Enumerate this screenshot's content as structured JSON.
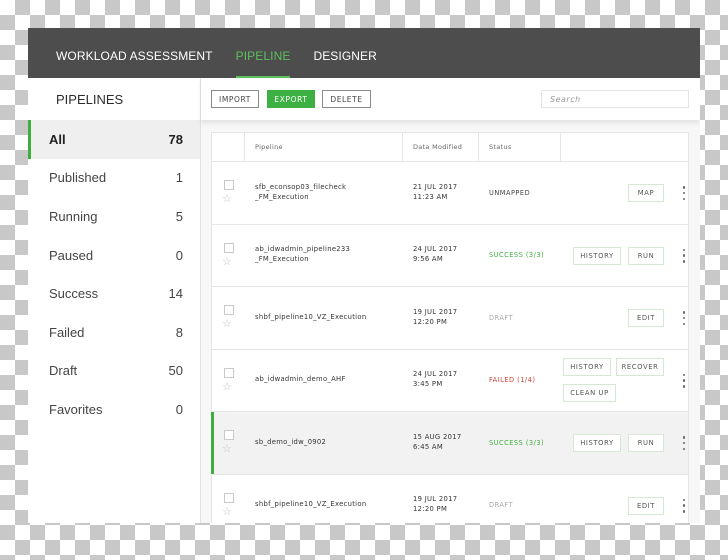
{
  "nav": {
    "tabs": [
      {
        "label": "WORKLOAD ASSESSMENT",
        "active": false
      },
      {
        "label": "PIPELINE",
        "active": true
      },
      {
        "label": "DESIGNER",
        "active": false
      }
    ]
  },
  "sidebar": {
    "title": "PIPELINES",
    "items": [
      {
        "label": "All",
        "count": "78",
        "active": true
      },
      {
        "label": "Published",
        "count": "1"
      },
      {
        "label": "Running",
        "count": "5"
      },
      {
        "label": "Paused",
        "count": "0"
      },
      {
        "label": "Success",
        "count": "14"
      },
      {
        "label": "Failed",
        "count": "8"
      },
      {
        "label": "Draft",
        "count": "50"
      },
      {
        "label": "Favorites",
        "count": "0"
      }
    ]
  },
  "toolbar": {
    "import_label": "IMPORT",
    "export_label": "EXPORT",
    "delete_label": "DELETE",
    "search_placeholder": "Search"
  },
  "table": {
    "columns": [
      "Pipeline",
      "Data Modified",
      "Status"
    ],
    "rows": [
      {
        "name_line1": "sfb_econsop03_filecheck",
        "name_line2": "_FM_Execution",
        "date": "21 JUL 2017",
        "time": "11:23 AM",
        "status": "UNMAPPED",
        "status_type": "unmapped",
        "actions": [
          "MAP"
        ]
      },
      {
        "name_line1": "ab_idwadmin_pipeline233",
        "name_line2": "_FM_Execution",
        "date": "24 JUL 2017",
        "time": "9:56 AM",
        "status": "SUCCESS (3/3)",
        "status_type": "success",
        "actions": [
          "HISTORY",
          "RUN"
        ]
      },
      {
        "name_line1": "shbf_pipeline10_VZ_Execution",
        "name_line2": "",
        "date": "19 JUL 2017",
        "time": "12:20 PM",
        "status": "DRAFT",
        "status_type": "draft",
        "actions": [
          "EDIT"
        ]
      },
      {
        "name_line1": "ab_idwadmin_demo_AHF",
        "name_line2": "",
        "date": "24 JUL 2017",
        "time": "3:45 PM",
        "status": "FAILED (1/4)",
        "status_type": "failed",
        "actions": [
          "HISTORY",
          "RECOVER",
          "CLEAN UP"
        ]
      },
      {
        "name_line1": "sb_demo_idw_0902",
        "name_line2": "",
        "date": "15 AUG 2017",
        "time": "6:45 AM",
        "status": "SUCCESS (3/3)",
        "status_type": "success",
        "actions": [
          "HISTORY",
          "RUN"
        ],
        "highlighted": true
      },
      {
        "name_line1": "shbf_pipeline10_VZ_Execution",
        "name_line2": "",
        "date": "19 JUL 2017",
        "time": "12:20 PM",
        "status": "DRAFT",
        "status_type": "draft",
        "actions": [
          "EDIT"
        ]
      }
    ]
  },
  "colors": {
    "accent_green": "#3fae3f",
    "nav_bg": "#4d4d4d",
    "failed_red": "#d0453a",
    "draft_gray": "#a8a8a8"
  }
}
